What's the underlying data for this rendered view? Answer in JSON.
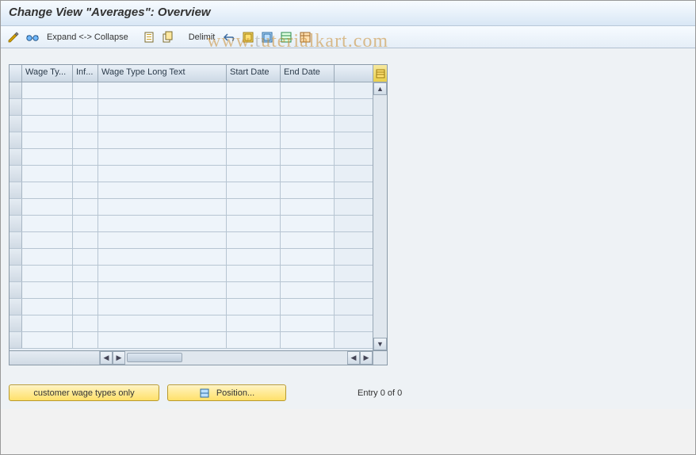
{
  "title": "Change View \"Averages\": Overview",
  "toolbar": {
    "expand_collapse": "Expand <-> Collapse",
    "delimit": "Delimit"
  },
  "columns": {
    "wage_type": "Wage Ty...",
    "inf": "Inf...",
    "long_text": "Wage Type Long Text",
    "start_date": "Start Date",
    "end_date": "End Date"
  },
  "rows": [
    {
      "wage_type": "",
      "inf": "",
      "long_text": "",
      "start_date": "",
      "end_date": ""
    },
    {
      "wage_type": "",
      "inf": "",
      "long_text": "",
      "start_date": "",
      "end_date": ""
    },
    {
      "wage_type": "",
      "inf": "",
      "long_text": "",
      "start_date": "",
      "end_date": ""
    },
    {
      "wage_type": "",
      "inf": "",
      "long_text": "",
      "start_date": "",
      "end_date": ""
    },
    {
      "wage_type": "",
      "inf": "",
      "long_text": "",
      "start_date": "",
      "end_date": ""
    },
    {
      "wage_type": "",
      "inf": "",
      "long_text": "",
      "start_date": "",
      "end_date": ""
    },
    {
      "wage_type": "",
      "inf": "",
      "long_text": "",
      "start_date": "",
      "end_date": ""
    },
    {
      "wage_type": "",
      "inf": "",
      "long_text": "",
      "start_date": "",
      "end_date": ""
    },
    {
      "wage_type": "",
      "inf": "",
      "long_text": "",
      "start_date": "",
      "end_date": ""
    },
    {
      "wage_type": "",
      "inf": "",
      "long_text": "",
      "start_date": "",
      "end_date": ""
    },
    {
      "wage_type": "",
      "inf": "",
      "long_text": "",
      "start_date": "",
      "end_date": ""
    },
    {
      "wage_type": "",
      "inf": "",
      "long_text": "",
      "start_date": "",
      "end_date": ""
    },
    {
      "wage_type": "",
      "inf": "",
      "long_text": "",
      "start_date": "",
      "end_date": ""
    },
    {
      "wage_type": "",
      "inf": "",
      "long_text": "",
      "start_date": "",
      "end_date": ""
    },
    {
      "wage_type": "",
      "inf": "",
      "long_text": "",
      "start_date": "",
      "end_date": ""
    },
    {
      "wage_type": "",
      "inf": "",
      "long_text": "",
      "start_date": "",
      "end_date": ""
    }
  ],
  "buttons": {
    "customer_wage_types": "customer wage types only",
    "position": "Position..."
  },
  "status": {
    "entry_text": "Entry 0 of 0"
  },
  "watermark": {
    "light": "www.",
    "dark_mid": "t",
    "light2": "u",
    "rest": "terialkart.com"
  }
}
